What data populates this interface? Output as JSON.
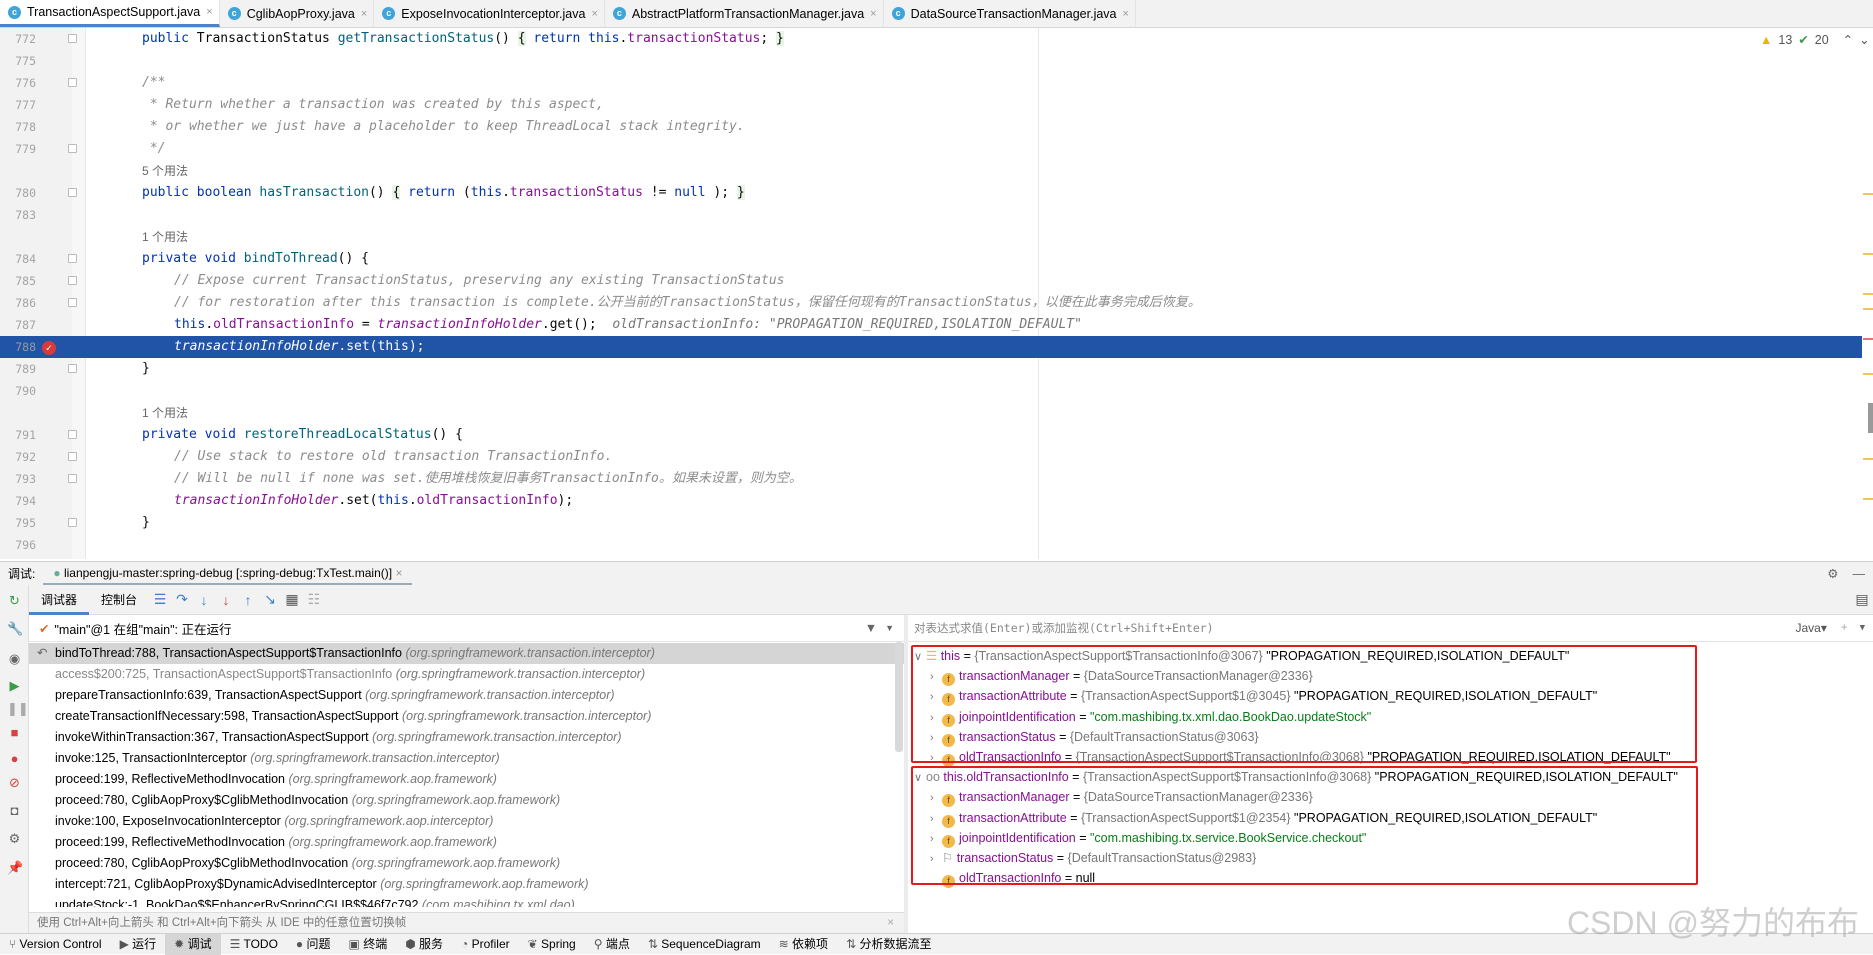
{
  "tabs": [
    {
      "label": "TransactionAspectSupport.java",
      "active": true
    },
    {
      "label": "CglibAopProxy.java"
    },
    {
      "label": "ExposeInvocationInterceptor.java"
    },
    {
      "label": "AbstractPlatformTransactionManager.java"
    },
    {
      "label": "DataSourceTransactionManager.java"
    }
  ],
  "inspection": {
    "warnings": "13",
    "checks": "20"
  },
  "code": [
    {
      "ln": "772",
      "fold": true,
      "ind": 1,
      "t": [
        [
          "kw",
          "public "
        ],
        [
          "",
          "TransactionStatus "
        ],
        [
          "fn",
          "getTransactionStatus"
        ],
        [
          "",
          "() "
        ],
        [
          "br",
          "{"
        ],
        [
          "kw",
          " return this"
        ],
        [
          "",
          "."
        ],
        [
          "field",
          "transactionStatus"
        ],
        [
          "",
          "; "
        ],
        [
          "br",
          "}"
        ]
      ]
    },
    {
      "ln": "775",
      "t": []
    },
    {
      "ln": "776",
      "fold": true,
      "ind": 1,
      "t": [
        [
          "cm",
          "/**"
        ]
      ]
    },
    {
      "ln": "777",
      "ind": 1,
      "t": [
        [
          "cm",
          " * Return whether a transaction was created by this aspect,"
        ]
      ]
    },
    {
      "ln": "778",
      "ind": 1,
      "t": [
        [
          "cm",
          " * or whether we just have a placeholder to keep ThreadLocal stack integrity."
        ]
      ]
    },
    {
      "ln": "779",
      "fold": true,
      "ind": 1,
      "t": [
        [
          "cm",
          " */"
        ]
      ]
    },
    {
      "usage": "5 个用法"
    },
    {
      "ln": "780",
      "fold": true,
      "ind": 1,
      "t": [
        [
          "kw",
          "public boolean "
        ],
        [
          "fn",
          "hasTransaction"
        ],
        [
          "",
          "() "
        ],
        [
          "br",
          "{"
        ],
        [
          "kw",
          " return "
        ],
        [
          "",
          "("
        ],
        [
          "kw",
          "this"
        ],
        [
          "",
          "."
        ],
        [
          "field",
          "transactionStatus"
        ],
        [
          "",
          " != "
        ],
        [
          "kw",
          "null"
        ],
        [
          "",
          " ); "
        ],
        [
          "br",
          "}"
        ]
      ]
    },
    {
      "ln": "783",
      "t": []
    },
    {
      "usage": "1 个用法"
    },
    {
      "ln": "784",
      "fold": true,
      "ind": 1,
      "t": [
        [
          "kw",
          "private void "
        ],
        [
          "fn",
          "bindToThread"
        ],
        [
          "",
          "() {"
        ]
      ]
    },
    {
      "ln": "785",
      "fold": true,
      "ind": 2,
      "t": [
        [
          "cm",
          "// Expose current TransactionStatus, preserving any existing TransactionStatus"
        ]
      ]
    },
    {
      "ln": "786",
      "fold": true,
      "ind": 2,
      "t": [
        [
          "cm",
          "// for restoration after this transaction is complete.公开当前的TransactionStatus，保留任何现有的TransactionStatus，以便在此事务完成后恢复。"
        ]
      ]
    },
    {
      "ln": "787",
      "ind": 2,
      "t": [
        [
          "kw",
          "this"
        ],
        [
          "",
          "."
        ],
        [
          "field",
          "oldTransactionInfo"
        ],
        [
          "",
          " = "
        ],
        [
          "st",
          "transactionInfoHolder"
        ],
        [
          "",
          ".get();  "
        ],
        [
          "hint",
          "oldTransactionInfo: \"PROPAGATION_REQUIRED,ISOLATION_DEFAULT\""
        ]
      ]
    },
    {
      "ln": "788",
      "exec": true,
      "ind": 2,
      "t": [
        [
          "st",
          "transactionInfoHolder"
        ],
        [
          "",
          ".set(this);"
        ]
      ]
    },
    {
      "ln": "789",
      "fold": true,
      "ind": 1,
      "t": [
        [
          "",
          "}"
        ]
      ]
    },
    {
      "ln": "790",
      "t": []
    },
    {
      "usage": "1 个用法"
    },
    {
      "ln": "791",
      "fold": true,
      "ind": 1,
      "t": [
        [
          "kw",
          "private void "
        ],
        [
          "fn",
          "restoreThreadLocalStatus"
        ],
        [
          "",
          "() {"
        ]
      ]
    },
    {
      "ln": "792",
      "fold": true,
      "ind": 2,
      "t": [
        [
          "cm",
          "// Use stack to restore old transaction TransactionInfo."
        ]
      ]
    },
    {
      "ln": "793",
      "fold": true,
      "ind": 2,
      "t": [
        [
          "cm",
          "// Will be null if none was set.使用堆栈恢复旧事务TransactionInfo。如果未设置，则为空。"
        ]
      ]
    },
    {
      "ln": "794",
      "ind": 2,
      "t": [
        [
          "st",
          "transactionInfoHolder"
        ],
        [
          "",
          ".set("
        ],
        [
          "kw",
          "this"
        ],
        [
          "",
          "."
        ],
        [
          "field",
          "oldTransactionInfo"
        ],
        [
          "",
          ");"
        ]
      ]
    },
    {
      "ln": "795",
      "fold": true,
      "ind": 1,
      "t": [
        [
          "",
          "}"
        ]
      ]
    },
    {
      "ln": "796",
      "t": []
    }
  ],
  "debug": {
    "label": "调试:",
    "session": "lianpengju-master:spring-debug [:spring-debug:TxTest.main()]",
    "tabs": [
      "调试器",
      "控制台"
    ],
    "thread": "\"main\"@1 在组\"main\": 正在运行",
    "hint": "使用 Ctrl+Alt+向上箭头 和 Ctrl+Alt+向下箭头 从 IDE 中的任意位置切换帧",
    "eval_placeholder": "对表达式求值(Enter)或添加监视(Ctrl+Shift+Enter)",
    "lang": "Java"
  },
  "frames": [
    {
      "m": "bindToThread:788, TransactionAspectSupport$TransactionInfo",
      "p": "(org.springframework.transaction.interceptor)",
      "sel": true
    },
    {
      "m": "access$200:725, TransactionAspectSupport$TransactionInfo",
      "p": "(org.springframework.transaction.interceptor)",
      "dim": true
    },
    {
      "m": "prepareTransactionInfo:639, TransactionAspectSupport",
      "p": "(org.springframework.transaction.interceptor)"
    },
    {
      "m": "createTransactionIfNecessary:598, TransactionAspectSupport",
      "p": "(org.springframework.transaction.interceptor)"
    },
    {
      "m": "invokeWithinTransaction:367, TransactionAspectSupport",
      "p": "(org.springframework.transaction.interceptor)"
    },
    {
      "m": "invoke:125, TransactionInterceptor",
      "p": "(org.springframework.transaction.interceptor)"
    },
    {
      "m": "proceed:199, ReflectiveMethodInvocation",
      "p": "(org.springframework.aop.framework)"
    },
    {
      "m": "proceed:780, CglibAopProxy$CglibMethodInvocation",
      "p": "(org.springframework.aop.framework)"
    },
    {
      "m": "invoke:100, ExposeInvocationInterceptor",
      "p": "(org.springframework.aop.interceptor)"
    },
    {
      "m": "proceed:199, ReflectiveMethodInvocation",
      "p": "(org.springframework.aop.framework)"
    },
    {
      "m": "proceed:780, CglibAopProxy$CglibMethodInvocation",
      "p": "(org.springframework.aop.framework)"
    },
    {
      "m": "intercept:721, CglibAopProxy$DynamicAdvisedInterceptor",
      "p": "(org.springframework.aop.framework)"
    },
    {
      "m": "updateStock:-1, BookDao$$EnhancerBySpringCGLIB$$46f7c792",
      "p": "(com.mashibing.tx.xml.dao)"
    }
  ],
  "variables": [
    {
      "lvl": 0,
      "exp": "open",
      "icon": "stack",
      "n": "this",
      "ty": "{TransactionAspectSupport$TransactionInfo@3067}",
      "v": "\"PROPAGATION_REQUIRED,ISOLATION_DEFAULT\""
    },
    {
      "lvl": 1,
      "exp": "closed",
      "icon": "f",
      "n": "transactionManager",
      "ty": "{DataSourceTransactionManager@2336}"
    },
    {
      "lvl": 1,
      "exp": "closed",
      "icon": "f",
      "n": "transactionAttribute",
      "ty": "{TransactionAspectSupport$1@3045}",
      "v": "\"PROPAGATION_REQUIRED,ISOLATION_DEFAULT\""
    },
    {
      "lvl": 1,
      "exp": "closed",
      "icon": "f",
      "n": "joinpointIdentification",
      "s": "\"com.mashibing.tx.xml.dao.BookDao.updateStock\""
    },
    {
      "lvl": 1,
      "exp": "closed",
      "icon": "f",
      "n": "transactionStatus",
      "ty": "{DefaultTransactionStatus@3063}"
    },
    {
      "lvl": 1,
      "exp": "closed",
      "icon": "f",
      "n": "oldTransactionInfo",
      "ty": "{TransactionAspectSupport$TransactionInfo@3068}",
      "v": "\"PROPAGATION_REQUIRED,ISOLATION_DEFAULT\""
    },
    {
      "lvl": 0,
      "exp": "open",
      "icon": "watch",
      "n": "this.oldTransactionInfo",
      "ty": "{TransactionAspectSupport$TransactionInfo@3068}",
      "v": "\"PROPAGATION_REQUIRED,ISOLATION_DEFAULT\""
    },
    {
      "lvl": 1,
      "exp": "closed",
      "icon": "f",
      "n": "transactionManager",
      "ty": "{DataSourceTransactionManager@2336}"
    },
    {
      "lvl": 1,
      "exp": "closed",
      "icon": "f",
      "n": "transactionAttribute",
      "ty": "{TransactionAspectSupport$1@2354}",
      "v": "\"PROPAGATION_REQUIRED,ISOLATION_DEFAULT\""
    },
    {
      "lvl": 1,
      "exp": "closed",
      "icon": "f",
      "n": "joinpointIdentification",
      "s": "\"com.mashibing.tx.service.BookService.checkout\""
    },
    {
      "lvl": 1,
      "exp": "closed",
      "icon": "flag",
      "n": "transactionStatus",
      "ty": "{DefaultTransactionStatus@2983}"
    },
    {
      "lvl": 1,
      "exp": "none",
      "icon": "f",
      "n": "oldTransactionInfo",
      "plain": "null"
    }
  ],
  "statusbar": [
    {
      "label": "Version Control",
      "icon": "vcs"
    },
    {
      "label": "运行",
      "icon": "run"
    },
    {
      "label": "调试",
      "icon": "debug",
      "active": true
    },
    {
      "label": "TODO",
      "icon": "todo"
    },
    {
      "label": "问题",
      "icon": "problems"
    },
    {
      "label": "终端",
      "icon": "terminal"
    },
    {
      "label": "服务",
      "icon": "services"
    },
    {
      "label": "Profiler",
      "icon": "profiler"
    },
    {
      "label": "Spring",
      "icon": "spring"
    },
    {
      "label": "端点",
      "icon": "endpoints"
    },
    {
      "label": "SequenceDiagram",
      "icon": "sequence"
    },
    {
      "label": "依赖项",
      "icon": "dependencies"
    },
    {
      "label": "分析数据流至",
      "icon": "dataflow"
    }
  ],
  "watermark": "CSDN @努力的布布",
  "colors": {
    "accent": "#4a86c7",
    "exec_line": "#2154a6",
    "highlight_box": "#e61a1a"
  }
}
